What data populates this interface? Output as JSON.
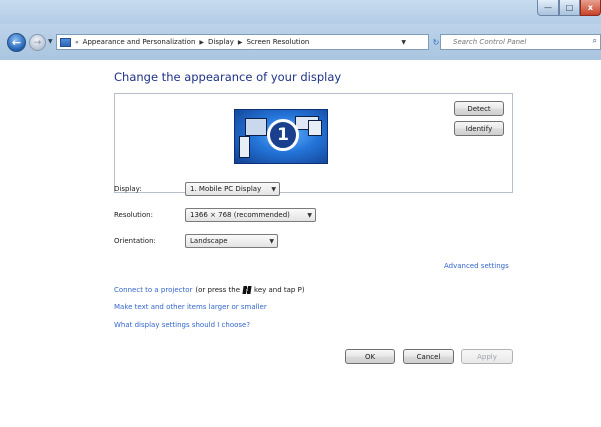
{
  "window": {
    "title": "",
    "controls": {
      "minimize": "—",
      "maximize": "□",
      "close": "x"
    },
    "colors": {
      "chrome": "#b8d0e8",
      "close": "#c8432b"
    }
  },
  "nav": {
    "back_icon": "back-arrow-icon",
    "forward_icon": "forward-arrow-icon",
    "recent_icon": "dropdown-arrow-icon",
    "breadcrumb_prefix": "«",
    "breadcrumb": [
      "Appearance and Personalization",
      "Display",
      "Screen Resolution"
    ],
    "refresh_icon": "refresh-icon",
    "search_placeholder": "Search Control Panel"
  },
  "page": {
    "title": "Change the appearance of your display",
    "monitor_number": "1",
    "detect_label": "Detect",
    "identify_label": "Identify"
  },
  "settings": {
    "display": {
      "label": "Display:",
      "value": "1. Mobile PC Display"
    },
    "resolution": {
      "label": "Resolution:",
      "value": "1366 × 768 (recommended)"
    },
    "orientation": {
      "label": "Orientation:",
      "value": "Landscape"
    }
  },
  "links": {
    "advanced": "Advanced settings",
    "projector": "Connect to a projector",
    "projector_note_a": "(or press the",
    "projector_note_b": "key and tap P)",
    "text_size": "Make text and other items larger or smaller",
    "choose": "What display settings should I choose?",
    "link_color": "#3366cc"
  },
  "footer": {
    "ok": "OK",
    "cancel": "Cancel",
    "apply": "Apply"
  }
}
